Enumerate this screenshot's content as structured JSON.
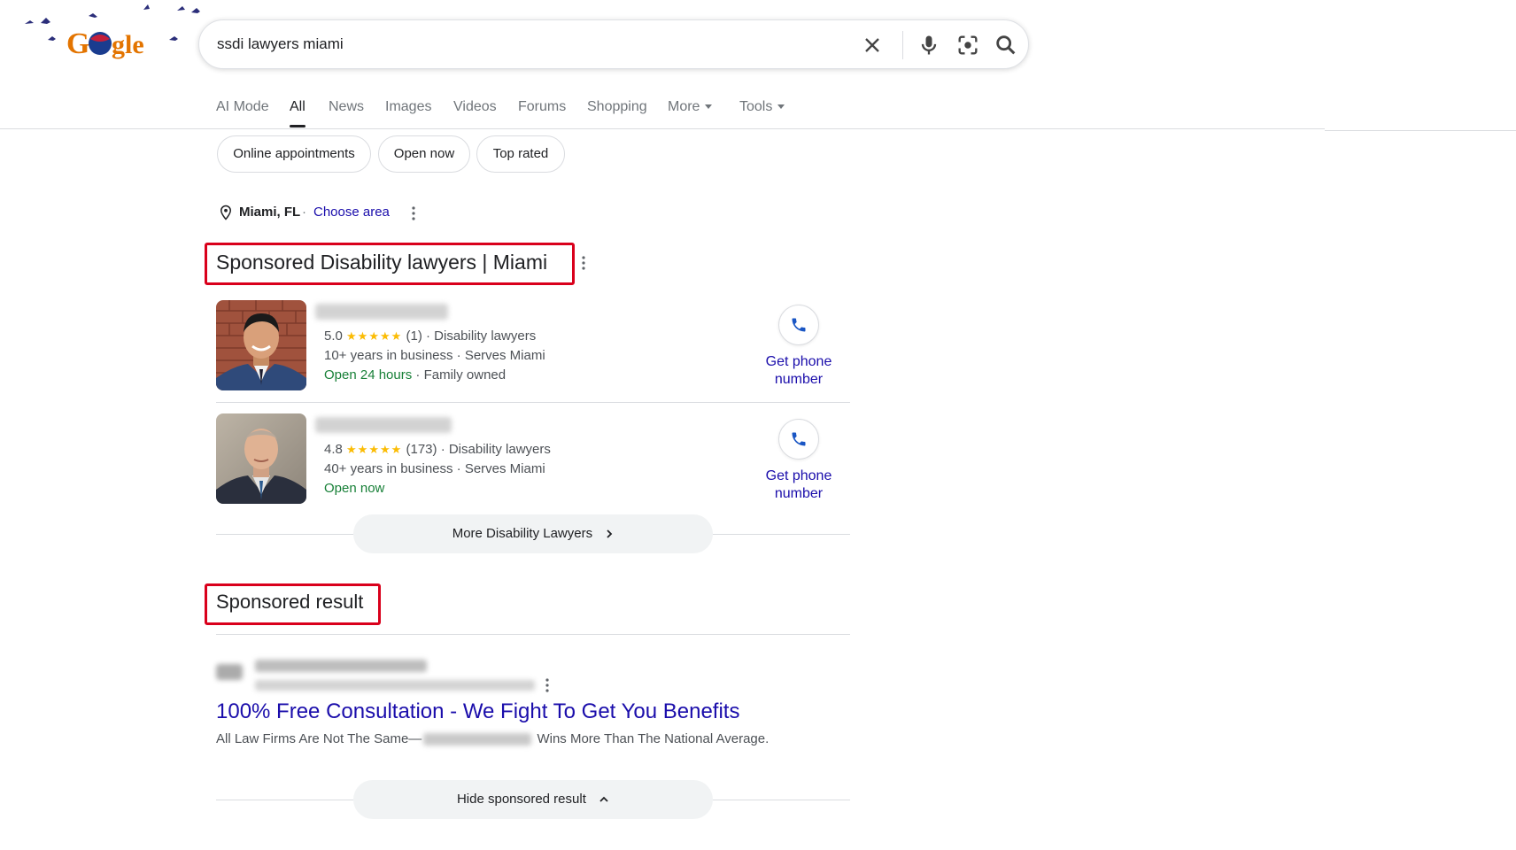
{
  "search": {
    "query": "ssdi lawyers miami"
  },
  "tabs": [
    {
      "label": "AI Mode"
    },
    {
      "label": "All"
    },
    {
      "label": "News"
    },
    {
      "label": "Images"
    },
    {
      "label": "Videos"
    },
    {
      "label": "Forums"
    },
    {
      "label": "Shopping"
    },
    {
      "label": "More"
    },
    {
      "label": "Tools"
    }
  ],
  "chips": [
    "Online appointments",
    "Open now",
    "Top rated"
  ],
  "location": {
    "city": "Miami, FL",
    "separator": "·",
    "link": "Choose area"
  },
  "local_ads": {
    "heading": "Sponsored Disability lawyers | Miami",
    "listings": [
      {
        "rating": "5.0",
        "stars": "★★★★★",
        "reviews": "(1)",
        "category": "· Disability lawyers",
        "experience": "10+ years in business · Serves Miami",
        "hours": "Open 24 hours",
        "extra": "· Family owned",
        "phone_label": "Get phone number"
      },
      {
        "rating": "4.8",
        "stars": "★★★★★",
        "reviews": "(173)",
        "category": "· Disability lawyers",
        "experience": "40+ years in business · Serves Miami",
        "hours": "Open now",
        "extra": "",
        "phone_label": "Get phone number"
      }
    ],
    "more_button": "More Disability Lawyers"
  },
  "sponsored_result": {
    "heading": "Sponsored result",
    "title": "100% Free Consultation - We Fight To Get You Benefits",
    "desc_start": "All Law Firms Are Not The Same—",
    "desc_end": "Wins More Than The National Average.",
    "hide_button": "Hide sponsored result"
  },
  "colors": {
    "link": "#1a0dab",
    "open_green": "#188038",
    "star": "#fbbc04",
    "highlight_box": "#d9001b"
  },
  "icons": [
    "google-doodle-logo",
    "clear-icon",
    "microphone-icon",
    "lens-icon",
    "search-icon",
    "location-pin-icon",
    "more-vert-icon",
    "phone-icon",
    "chevron-right-icon",
    "chevron-up-icon"
  ]
}
